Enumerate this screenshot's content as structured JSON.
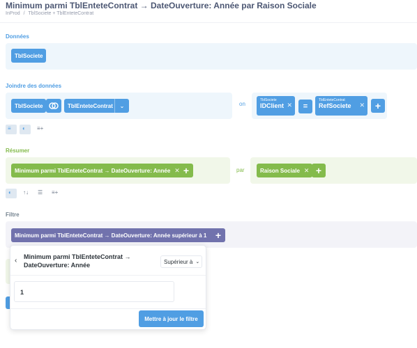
{
  "header": {
    "title": "Minimum parmi TblEnteteContrat → DateOuverture: Année par Raison Sociale",
    "breadcrumb": [
      "InProd",
      "/",
      "TblSociete + TblEnteteContrat"
    ]
  },
  "data_section": {
    "label": "Données",
    "table": "TblSociete"
  },
  "join_section": {
    "label": "Joindre des données",
    "left_table": "TblSociete",
    "join_type_icon": "join-left-icon",
    "right_table": "TblEnteteContrat",
    "on_label": "on",
    "left_field_table": "TblSociete",
    "left_field": "IDClient",
    "operator": "=",
    "right_field_table": "TblEnteteContrat",
    "right_field": "RefSociete"
  },
  "summarize_section": {
    "label": "Résumer",
    "metric": "Minimum parmi TblEnteteContrat → DateOuverture: Année",
    "by_label": "par",
    "breakout": "Raison Sociale"
  },
  "filter_section": {
    "label": "Filtre",
    "filter": "Minimum parmi TblEnteteContrat → DateOuverture: Année supérieur à 1"
  },
  "popover": {
    "title": "Minimum parmi TblEnteteContrat → DateOuverture: Année",
    "operator": "Supérieur à",
    "value": "1",
    "update_button": "Mettre à jour le filtre"
  },
  "colors": {
    "blue": "#509ee3",
    "green": "#84bb4c",
    "purple": "#7172ad"
  }
}
